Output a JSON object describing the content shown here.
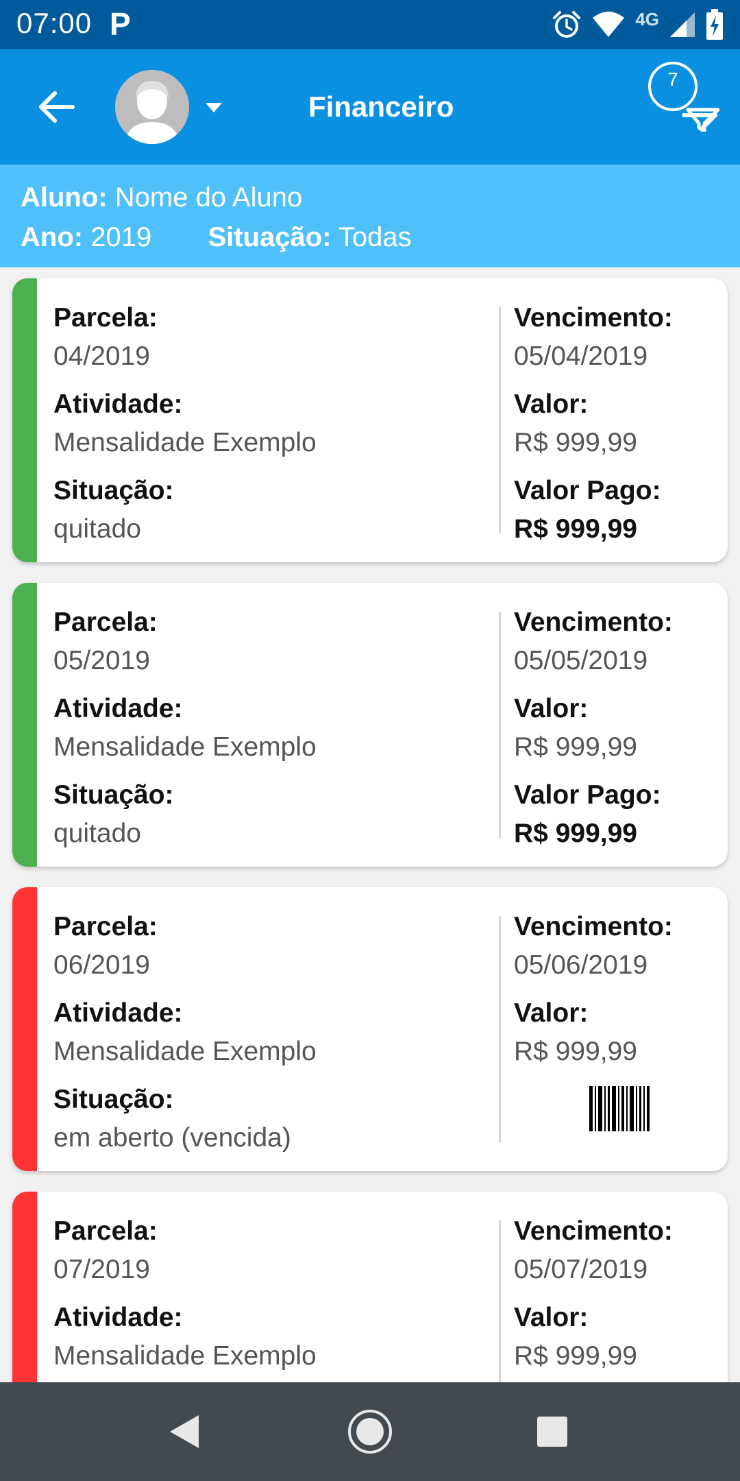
{
  "status_bar": {
    "time": "07:00",
    "notification_letter": "P",
    "network": "4G"
  },
  "app_bar": {
    "title": "Financeiro",
    "notification_count": "7",
    "icons": [
      "back-arrow-icon",
      "avatar",
      "caret-down-icon",
      "filter-funnel-icon"
    ]
  },
  "filter": {
    "student_label": "Aluno:",
    "student_value": "Nome do Aluno",
    "year_label": "Ano:",
    "year_value": "2019",
    "status_label": "Situação:",
    "status_value": "Todas"
  },
  "labels": {
    "installment": "Parcela:",
    "activity": "Atividade:",
    "status": "Situação:",
    "due_date": "Vencimento:",
    "amount": "Valor:",
    "amount_paid": "Valor Pago:"
  },
  "cards": [
    {
      "installment": "04/2019",
      "activity": "Mensalidade Exemplo",
      "status": "quitado",
      "due_date": "05/04/2019",
      "amount": "R$ 999,99",
      "amount_paid": "R$ 999,99",
      "stripe_color": "#4caf50"
    },
    {
      "installment": "05/2019",
      "activity": "Mensalidade Exemplo",
      "status": "quitado",
      "due_date": "05/05/2019",
      "amount": "R$ 999,99",
      "amount_paid": "R$ 999,99",
      "stripe_color": "#4caf50"
    },
    {
      "installment": "06/2019",
      "activity": "Mensalidade Exemplo",
      "status": "em aberto (vencida)",
      "due_date": "05/06/2019",
      "amount": "R$ 999,99",
      "action_icon": "barcode-icon",
      "stripe_color": "#ff3535"
    },
    {
      "installment": "07/2019",
      "activity": "Mensalidade Exemplo",
      "due_date": "05/07/2019",
      "amount": "R$ 999,99",
      "stripe_color": "#ff3535"
    }
  ],
  "colors": {
    "status_bar": "#005a9b",
    "app_bar": "#0a90e1",
    "filter_strip": "#4fc0fa",
    "paid": "#4caf50",
    "overdue": "#ff3535",
    "nav_bar": "#434a4f"
  },
  "nav_bar": {
    "icons": [
      "nav-back-icon",
      "nav-home-icon",
      "nav-recents-icon"
    ]
  }
}
